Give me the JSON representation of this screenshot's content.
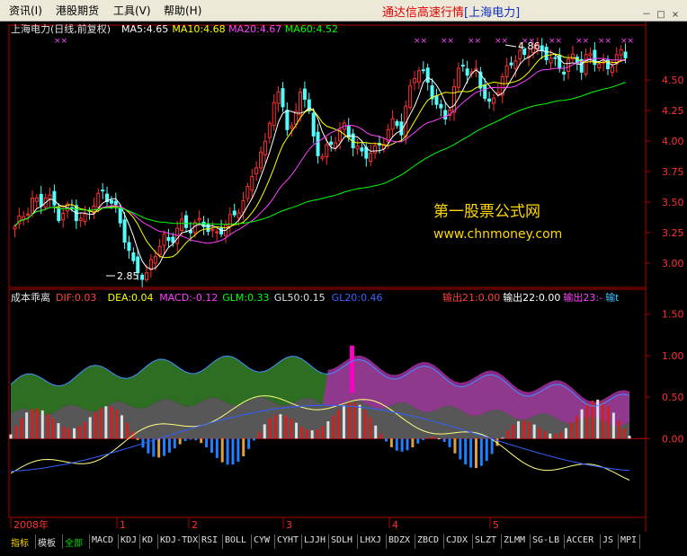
{
  "menu": {
    "items": [
      "资讯(I)",
      "港股期货",
      "工具(V)",
      "帮助(H)"
    ],
    "title_prefix": "通达信高速行情",
    "title_stock": "[上海电力]"
  },
  "window_buttons": [
    "－",
    "□",
    "×"
  ],
  "main_panel": {
    "header_name": "上海电力(日线,前复权)",
    "ma_labels": [
      {
        "text": "MA5:4.65",
        "color": "#ffffff"
      },
      {
        "text": "MA10:4.68",
        "color": "#ffff00"
      },
      {
        "text": "MA20:4.67",
        "color": "#ff40ff"
      },
      {
        "text": "MA60:4.52",
        "color": "#00ff00"
      }
    ],
    "watermark_line1": "第一股票公式网",
    "watermark_line2": "www.chnmoney.com",
    "high_marker": "4.86",
    "low_marker": "2.85",
    "marker_glyph": "××"
  },
  "indicator_panel": {
    "name": "成本乖离",
    "labels": [
      {
        "text": "DIF:0.03",
        "color": "#ff4040"
      },
      {
        "text": "DEA:0.04",
        "color": "#ffff00"
      },
      {
        "text": "MACD:-0.12",
        "color": "#ff40ff"
      },
      {
        "text": "GLM:0.33",
        "color": "#00ff00"
      },
      {
        "text": "GL50:0.15",
        "color": "#e0e0e0"
      },
      {
        "text": "GL20:0.46",
        "color": "#4060ff"
      }
    ],
    "right_labels": [
      {
        "text": "输出21:0.00",
        "color": "#ff4040"
      },
      {
        "text": "输出22:0.00",
        "color": "#ffffff"
      },
      {
        "text": "输出23:-",
        "color": "#ff40ff"
      },
      {
        "text": "输t",
        "color": "#40c0ff"
      }
    ]
  },
  "axis": {
    "time_labels": [
      "2008年",
      "1",
      "2",
      "3",
      "4",
      "5"
    ]
  },
  "tabs": [
    {
      "label": "指标",
      "style": "active"
    },
    {
      "label": "模板",
      "style": "normal"
    },
    {
      "label": "全部",
      "style": "green"
    },
    {
      "label": "MACD",
      "style": "normal"
    },
    {
      "label": "KDJ",
      "style": "normal"
    },
    {
      "label": "KD",
      "style": "normal"
    },
    {
      "label": "KDJ-TDX",
      "style": "normal"
    },
    {
      "label": "RSI",
      "style": "normal"
    },
    {
      "label": "BOLL",
      "style": "normal"
    },
    {
      "label": "CYW",
      "style": "normal"
    },
    {
      "label": "CYHT",
      "style": "normal"
    },
    {
      "label": "LJJH",
      "style": "normal"
    },
    {
      "label": "SDLH",
      "style": "normal"
    },
    {
      "label": "LHXJ",
      "style": "normal"
    },
    {
      "label": "BDZX",
      "style": "normal"
    },
    {
      "label": "ZBCD",
      "style": "normal"
    },
    {
      "label": "CJDX",
      "style": "normal"
    },
    {
      "label": "SLZT",
      "style": "normal"
    },
    {
      "label": "ZLMM",
      "style": "normal"
    },
    {
      "label": "SG-LB",
      "style": "normal"
    },
    {
      "label": "ACCER",
      "style": "normal"
    },
    {
      "label": "JS",
      "style": "normal"
    },
    {
      "label": "MPI",
      "style": "normal"
    }
  ],
  "colors": {
    "up": "#ff3030",
    "down": "#54fcfc",
    "axis": "#b00000",
    "ma5": "#ffffff",
    "ma10": "#ffff00",
    "ma20": "#ff40ff",
    "ma60": "#00ff00"
  },
  "chart_data": [
    {
      "type": "candlestick",
      "title": "上海电力(日线,前复权)",
      "ylim": [
        2.8,
        4.95
      ],
      "yticks": [
        3.0,
        3.25,
        3.5,
        3.75,
        4.0,
        4.25,
        4.5
      ],
      "x_months": [
        "2008年",
        "1",
        "2",
        "3",
        "4",
        "5"
      ],
      "annotations": {
        "high": 4.86,
        "low": 2.85
      },
      "close_path": [
        3.3,
        3.35,
        3.4,
        3.5,
        3.45,
        3.55,
        3.5,
        3.4,
        3.45,
        3.5,
        3.4,
        3.35,
        3.45,
        3.5,
        3.55,
        3.5,
        3.45,
        3.3,
        3.15,
        3.0,
        2.95,
        2.9,
        3.05,
        3.15,
        3.2,
        3.15,
        3.25,
        3.3,
        3.25,
        3.3,
        3.35,
        3.3,
        3.25,
        3.3,
        3.35,
        3.4,
        3.45,
        3.5,
        3.7,
        3.8,
        3.9,
        4.2,
        4.4,
        4.3,
        4.1,
        4.2,
        4.5,
        4.3,
        4.0,
        3.85,
        3.9,
        3.95,
        4.05,
        4.1,
        4.0,
        3.95,
        3.9,
        3.95,
        3.95,
        4.0,
        4.1,
        4.15,
        4.05,
        4.3,
        4.5,
        4.6,
        4.5,
        4.4,
        4.3,
        4.2,
        4.35,
        4.55,
        4.65,
        4.5,
        4.55,
        4.4,
        4.25,
        4.35,
        4.5,
        4.6,
        4.7,
        4.75,
        4.7,
        4.8,
        4.75,
        4.7,
        4.65,
        4.6,
        4.55,
        4.65,
        4.7,
        4.6,
        4.75,
        4.7,
        4.65,
        4.6,
        4.65,
        4.7,
        4.68
      ],
      "ma_values": {
        "MA5": 4.65,
        "MA10": 4.68,
        "MA20": 4.67,
        "MA60": 4.52
      }
    },
    {
      "type": "bar",
      "title": "成本乖离",
      "ylim": [
        -0.95,
        1.8
      ],
      "yticks": [
        0.0,
        0.5,
        1.0,
        1.5
      ],
      "labels": [
        "0.00",
        "0.50",
        "1.00",
        "1.50"
      ],
      "values": {
        "DIF": 0.03,
        "DEA": 0.04,
        "MACD": -0.12,
        "GLM": 0.33,
        "GL50": 0.15,
        "GL20": 0.46
      }
    }
  ]
}
